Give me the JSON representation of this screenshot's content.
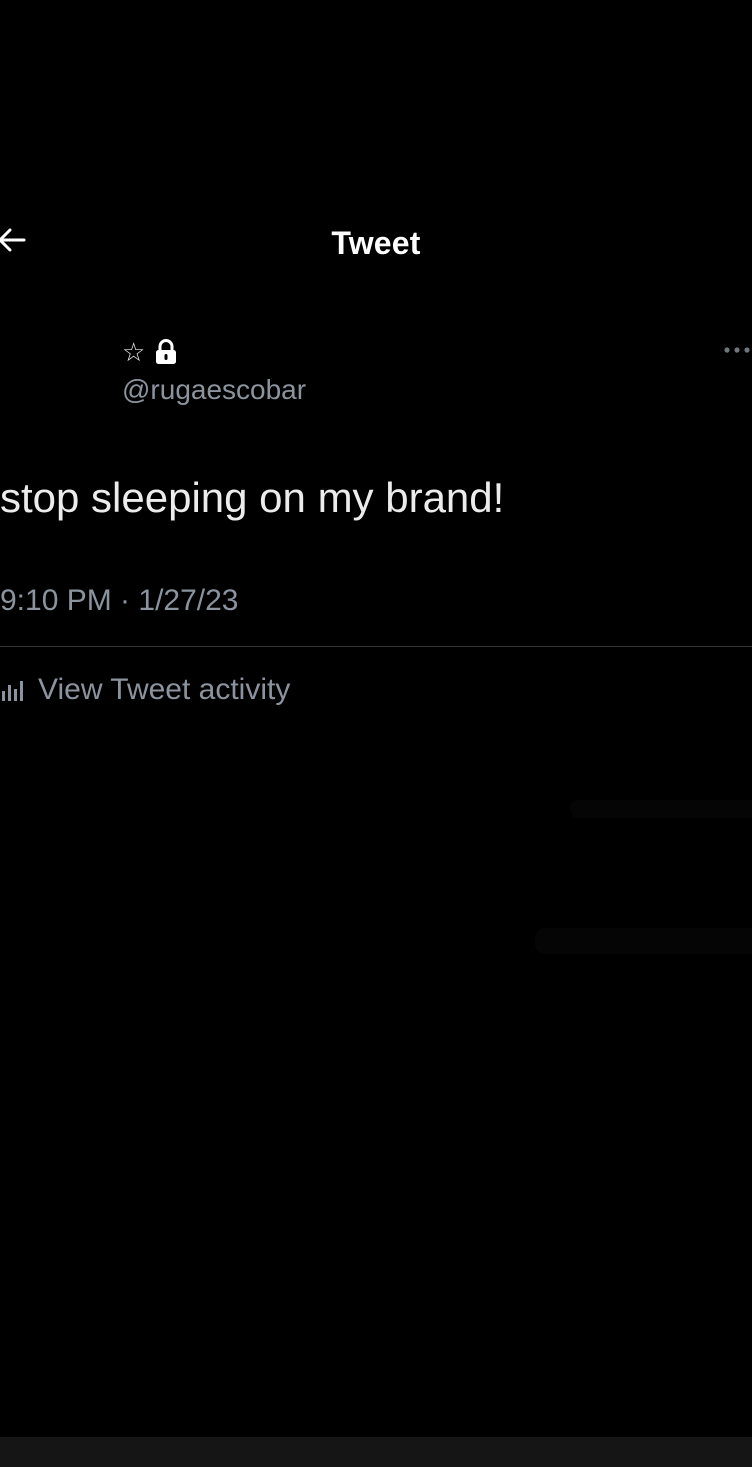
{
  "header": {
    "title": "Tweet",
    "back_icon": "arrow-left-icon"
  },
  "author": {
    "badge_icons": [
      "star-icon",
      "lock-icon"
    ],
    "star_glyph": "☆",
    "handle": "@rugaescobar",
    "more_icon": "more-horizontal-icon"
  },
  "tweet": {
    "text": "stop sleeping on my brand!",
    "timestamp": "9:10 PM · 1/27/23"
  },
  "activity": {
    "icon": "bar-chart-icon",
    "label": "View Tweet activity"
  },
  "colors": {
    "background": "#000000",
    "primary_text": "#e7e9ea",
    "secondary_text": "#8b949e",
    "divider": "#2f3336"
  }
}
